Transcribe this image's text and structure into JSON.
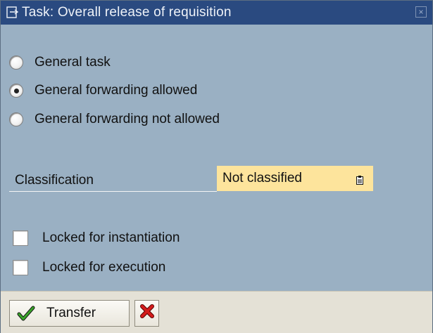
{
  "window": {
    "title": "Task: Overall release of requisition",
    "close_symbol": "×"
  },
  "radio_options": [
    {
      "label": "General task",
      "checked": false
    },
    {
      "label": "General forwarding allowed",
      "checked": true
    },
    {
      "label": "General forwarding not allowed",
      "checked": false
    }
  ],
  "classification": {
    "label": "Classification",
    "value": "Not classified"
  },
  "checkboxes": [
    {
      "label": "Locked for instantiation",
      "checked": false
    },
    {
      "label": "Locked for execution",
      "checked": false
    }
  ],
  "footer": {
    "transfer_label": "Transfer"
  },
  "icons": {
    "title": "task-window-icon",
    "transfer": "green-check-icon",
    "cancel": "red-x-icon",
    "value_help": "f4-help-icon"
  },
  "colors": {
    "titlebar": "#2a4a80",
    "body": "#9ab0c3",
    "field_highlight": "#fde49c",
    "footer": "#e4e1d6",
    "check_green": "#2f8f1f",
    "cancel_red": "#d41c1c"
  }
}
